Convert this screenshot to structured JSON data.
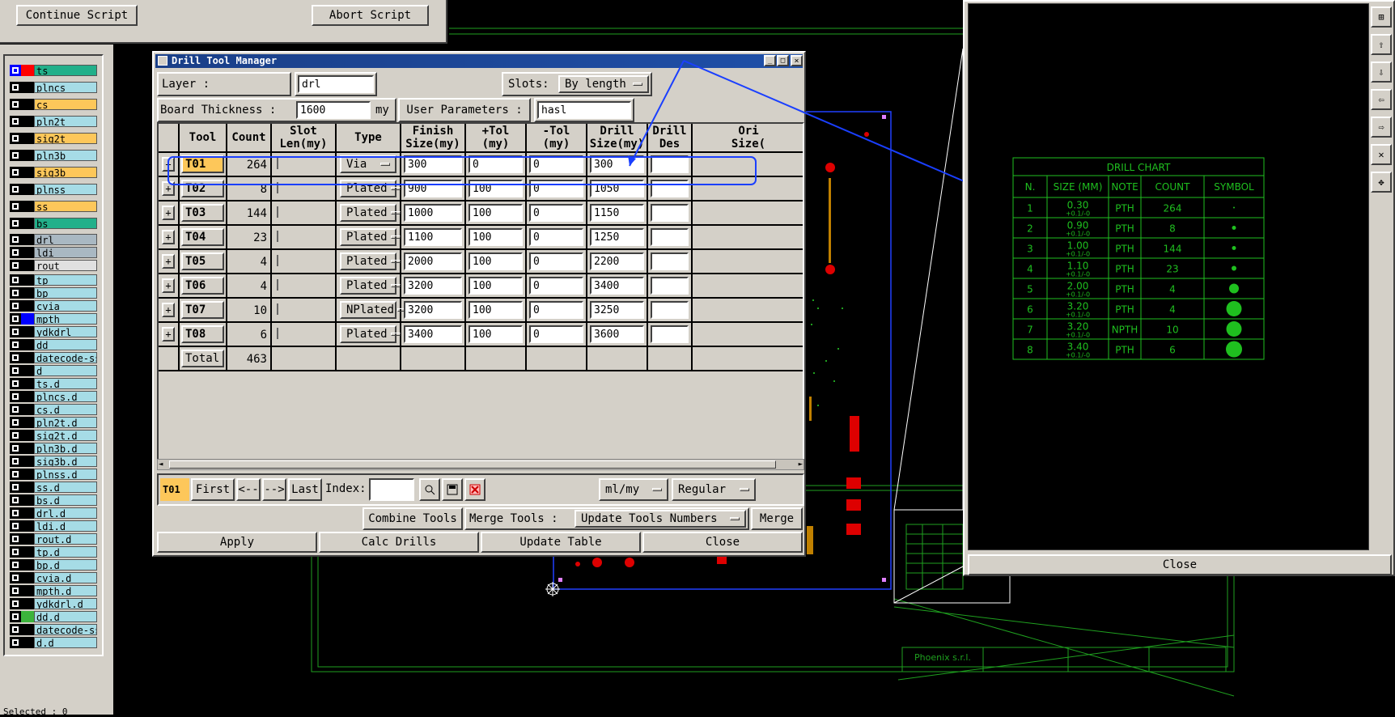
{
  "script_bar": {
    "continue_label": "Continue Script",
    "abort_label": "Abort Script"
  },
  "layers": [
    {
      "name": "ts",
      "color": "#22b08a",
      "swatch": "#ff0000",
      "first": "#0000ff"
    },
    {
      "name": "plncs",
      "color": "#a6dce6"
    },
    {
      "name": "cs",
      "color": "#fdc75a"
    },
    {
      "name": "pln2t",
      "color": "#a6dce6"
    },
    {
      "name": "sig2t",
      "color": "#fdc75a"
    },
    {
      "name": "pln3b",
      "color": "#a6dce6"
    },
    {
      "name": "sig3b",
      "color": "#fdc75a"
    },
    {
      "name": "plnss",
      "color": "#a6dce6"
    },
    {
      "name": "ss",
      "color": "#fdc75a"
    },
    {
      "name": "bs",
      "color": "#22b08a"
    },
    {
      "name": "drl",
      "color": "#a9b8c2"
    },
    {
      "name": "ldi",
      "color": "#a9b8c2"
    },
    {
      "name": "rout",
      "color": "#e0e0e0"
    },
    {
      "name": "tp",
      "color": "#a6dce6"
    },
    {
      "name": "bp",
      "color": "#a6dce6"
    },
    {
      "name": "cvia",
      "color": "#a6dce6"
    },
    {
      "name": "mpth",
      "color": "#a6dce6",
      "swatch": "#0000ff"
    },
    {
      "name": "ydkdrl",
      "color": "#a6dce6"
    },
    {
      "name": "dd",
      "color": "#a6dce6"
    },
    {
      "name": "datecode-ss",
      "color": "#a6dce6"
    },
    {
      "name": "d",
      "color": "#a6dce6"
    },
    {
      "name": "ts.d",
      "color": "#a6dce6"
    },
    {
      "name": "plncs.d",
      "color": "#a6dce6"
    },
    {
      "name": "cs.d",
      "color": "#a6dce6"
    },
    {
      "name": "pln2t.d",
      "color": "#a6dce6"
    },
    {
      "name": "sig2t.d",
      "color": "#a6dce6"
    },
    {
      "name": "pln3b.d",
      "color": "#a6dce6"
    },
    {
      "name": "sig3b.d",
      "color": "#a6dce6"
    },
    {
      "name": "plnss.d",
      "color": "#a6dce6"
    },
    {
      "name": "ss.d",
      "color": "#a6dce6"
    },
    {
      "name": "bs.d",
      "color": "#a6dce6"
    },
    {
      "name": "drl.d",
      "color": "#a6dce6"
    },
    {
      "name": "ldi.d",
      "color": "#a6dce6"
    },
    {
      "name": "rout.d",
      "color": "#a6dce6"
    },
    {
      "name": "tp.d",
      "color": "#a6dce6"
    },
    {
      "name": "bp.d",
      "color": "#a6dce6"
    },
    {
      "name": "cvia.d",
      "color": "#a6dce6"
    },
    {
      "name": "mpth.d",
      "color": "#a6dce6"
    },
    {
      "name": "ydkdrl.d",
      "color": "#a6dce6"
    },
    {
      "name": "dd.d",
      "color": "#a6dce6",
      "swatch": "#3cb43c"
    },
    {
      "name": "datecode-ss",
      "color": "#a6dce6"
    },
    {
      "name": "d.d",
      "color": "#a6dce6"
    }
  ],
  "status": {
    "selected": "Selected : 0"
  },
  "dtm": {
    "title": "Drill Tool Manager",
    "layer_label": "Layer        :",
    "layer_value": "drl",
    "slots_label": "Slots:",
    "slots_value": "By length",
    "thickness_label": "Board Thickness :",
    "thickness_value": "1600",
    "thickness_unit": "my",
    "user_params_label": "User Parameters :",
    "user_params_value": "hasl",
    "headers": [
      "Tool",
      "Count",
      "Slot\nLen(my)",
      "Type",
      "Finish\nSize(my)",
      "+Tol\n(my)",
      "-Tol\n(my)",
      "Drill\nSize(my)",
      "Drill\nDes",
      "Ori\nSize("
    ],
    "rows": [
      {
        "tool": "T01",
        "count": "264",
        "type": "Via",
        "finish": "300",
        "ptol": "0",
        "ntol": "0",
        "drill": "300"
      },
      {
        "tool": "T02",
        "count": "8",
        "type": "Plated",
        "finish": "900",
        "ptol": "100",
        "ntol": "0",
        "drill": "1050"
      },
      {
        "tool": "T03",
        "count": "144",
        "type": "Plated",
        "finish": "1000",
        "ptol": "100",
        "ntol": "0",
        "drill": "1150"
      },
      {
        "tool": "T04",
        "count": "23",
        "type": "Plated",
        "finish": "1100",
        "ptol": "100",
        "ntol": "0",
        "drill": "1250"
      },
      {
        "tool": "T05",
        "count": "4",
        "type": "Plated",
        "finish": "2000",
        "ptol": "100",
        "ntol": "0",
        "drill": "2200"
      },
      {
        "tool": "T06",
        "count": "4",
        "type": "Plated",
        "finish": "3200",
        "ptol": "100",
        "ntol": "0",
        "drill": "3400"
      },
      {
        "tool": "T07",
        "count": "10",
        "type": "NPlated",
        "finish": "3200",
        "ptol": "100",
        "ntol": "0",
        "drill": "3250"
      },
      {
        "tool": "T08",
        "count": "6",
        "type": "Plated",
        "finish": "3400",
        "ptol": "100",
        "ntol": "0",
        "drill": "3600"
      }
    ],
    "total_label": "Total",
    "total_value": "463",
    "nav": {
      "current": "T01",
      "first": "First",
      "prev": "<--",
      "next": "-->",
      "last": "Last",
      "index_label": "Index:"
    },
    "units_value": "ml/my",
    "mode_value": "Regular",
    "combine": "Combine Tools",
    "merge_label": "Merge Tools :",
    "merge_value": "Update Tools Numbers",
    "merge": "Merge",
    "apply": "Apply",
    "calc": "Calc Drills",
    "update": "Update Table",
    "close": "Close"
  },
  "drill_chart": {
    "title": "DRILL CHART",
    "headers": [
      "N.",
      "SIZE (MM)",
      "NOTE",
      "COUNT",
      "SYMBOL"
    ],
    "rows": [
      {
        "n": "1",
        "size": "0.30",
        "tol": "+0.1/-0",
        "note": "PTH",
        "count": "264",
        "sym": 2
      },
      {
        "n": "2",
        "size": "0.90",
        "tol": "+0.1/-0",
        "note": "PTH",
        "count": "8",
        "sym": 5
      },
      {
        "n": "3",
        "size": "1.00",
        "tol": "+0.1/-0",
        "note": "PTH",
        "count": "144",
        "sym": 5
      },
      {
        "n": "4",
        "size": "1.10",
        "tol": "+0.1/-0",
        "note": "PTH",
        "count": "23",
        "sym": 6
      },
      {
        "n": "5",
        "size": "2.00",
        "tol": "+0.1/-0",
        "note": "PTH",
        "count": "4",
        "sym": 12
      },
      {
        "n": "6",
        "size": "3.20",
        "tol": "+0.1/-0",
        "note": "PTH",
        "count": "4",
        "sym": 19
      },
      {
        "n": "7",
        "size": "3.20",
        "tol": "+0.1/-0",
        "note": "NPTH",
        "count": "10",
        "sym": 19
      },
      {
        "n": "8",
        "size": "3.40",
        "tol": "+0.1/-0",
        "note": "PTH",
        "count": "6",
        "sym": 20
      }
    ]
  },
  "title_block": {
    "company": "Phoenix s.r.l."
  },
  "view_close": "Close"
}
